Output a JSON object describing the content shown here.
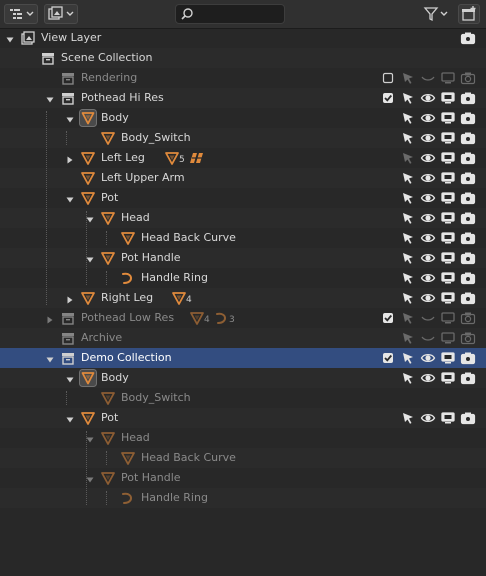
{
  "header": {
    "display_mode_icon": "outliner-display-mode-icon",
    "view_icon": "outliner-view-icon",
    "search": {
      "value": "",
      "placeholder": ""
    },
    "filter_icon": "filter-icon",
    "new_collection_icon": "new-collection-icon"
  },
  "colors": {
    "background": "#282828",
    "row_alt": "#2b2b2b",
    "selected_row": "#334d80",
    "object_orange": "#e08a3c",
    "collection_gray": "#d0d0d0"
  },
  "rows": [
    {
      "label": "View Layer",
      "depth": 0,
      "icon": "view-layer-icon",
      "expand": "open",
      "toggles": [
        "camera"
      ]
    },
    {
      "label": "Scene Collection",
      "depth": 1,
      "icon": "scene-collection-icon",
      "expand": "none",
      "toggles": []
    },
    {
      "label": "Rendering",
      "depth": 2,
      "icon": "collection-icon",
      "expand": "none",
      "dim": true,
      "toggles": [
        "checkbox-off",
        "select-off",
        "eye-closed",
        "monitor-off",
        "camera-off"
      ]
    },
    {
      "label": "Pothead Hi Res",
      "depth": 2,
      "icon": "collection-icon",
      "expand": "open",
      "toggles": [
        "checkbox-on",
        "select",
        "eye",
        "monitor",
        "camera"
      ]
    },
    {
      "label": "Body",
      "depth": 3,
      "icon": "object-boxed-icon",
      "expand": "open",
      "toggles": [
        "select",
        "eye",
        "monitor",
        "camera"
      ]
    },
    {
      "label": "Body_Switch",
      "depth": 4,
      "icon": "object-icon",
      "expand": "none",
      "toggles": [
        "select",
        "eye",
        "monitor",
        "camera"
      ]
    },
    {
      "label": "Left Leg",
      "depth": 3,
      "icon": "object-icon",
      "expand": "closed",
      "toggles": [
        "select-off",
        "eye",
        "monitor",
        "camera"
      ],
      "badges": [
        {
          "icon": "object-icon",
          "count": "5"
        },
        {
          "icon": "modifier-icon",
          "count": ""
        }
      ]
    },
    {
      "label": "Left Upper Arm",
      "depth": 3,
      "icon": "object-icon",
      "expand": "none",
      "toggles": [
        "select",
        "eye",
        "monitor",
        "camera"
      ]
    },
    {
      "label": "Pot",
      "depth": 3,
      "icon": "object-icon",
      "expand": "open",
      "toggles": [
        "select",
        "eye",
        "monitor",
        "camera"
      ]
    },
    {
      "label": "Head",
      "depth": 4,
      "icon": "object-icon",
      "expand": "open",
      "toggles": [
        "select",
        "eye",
        "monitor",
        "camera"
      ]
    },
    {
      "label": "Head Back Curve",
      "depth": 5,
      "icon": "object-icon",
      "expand": "none",
      "toggles": [
        "select",
        "eye",
        "monitor",
        "camera"
      ]
    },
    {
      "label": "Pot Handle",
      "depth": 4,
      "icon": "object-icon",
      "expand": "open",
      "toggles": [
        "select",
        "eye",
        "monitor",
        "camera"
      ]
    },
    {
      "label": "Handle Ring",
      "depth": 5,
      "icon": "curve-icon",
      "expand": "none",
      "toggles": [
        "select",
        "eye",
        "monitor",
        "camera"
      ]
    },
    {
      "label": "Right Leg",
      "depth": 3,
      "icon": "object-icon",
      "expand": "closed",
      "toggles": [
        "select",
        "eye",
        "monitor",
        "camera"
      ],
      "badges": [
        {
          "icon": "object-icon",
          "count": "4"
        }
      ]
    },
    {
      "label": "Pothead Low Res",
      "depth": 2,
      "icon": "collection-icon",
      "expand": "closed",
      "dim": true,
      "toggles": [
        "checkbox-on",
        "select-off",
        "eye-closed",
        "monitor-off",
        "camera-off"
      ],
      "badges": [
        {
          "icon": "object-icon",
          "count": "4"
        },
        {
          "icon": "curve-icon",
          "count": "3"
        }
      ]
    },
    {
      "label": "Archive",
      "depth": 2,
      "icon": "collection-icon",
      "expand": "none",
      "dim": true,
      "toggles": [
        "select-off",
        "eye-closed",
        "monitor-off",
        "camera-off"
      ]
    },
    {
      "label": "Demo Collection",
      "depth": 2,
      "icon": "collection-icon",
      "expand": "open",
      "selected": true,
      "toggles": [
        "checkbox-on",
        "select",
        "eye",
        "monitor",
        "camera"
      ]
    },
    {
      "label": "Body",
      "depth": 3,
      "icon": "object-boxed-icon",
      "expand": "open",
      "toggles": [
        "select",
        "eye",
        "monitor",
        "camera"
      ]
    },
    {
      "label": "Body_Switch",
      "depth": 4,
      "icon": "object-icon",
      "expand": "none",
      "dim": true,
      "toggles": []
    },
    {
      "label": "Pot",
      "depth": 3,
      "icon": "object-icon",
      "expand": "open",
      "toggles": [
        "select",
        "eye",
        "monitor",
        "camera"
      ]
    },
    {
      "label": "Head",
      "depth": 4,
      "icon": "object-icon",
      "expand": "open",
      "dim": true,
      "toggles": []
    },
    {
      "label": "Head Back Curve",
      "depth": 5,
      "icon": "object-icon",
      "expand": "none",
      "dim": true,
      "toggles": []
    },
    {
      "label": "Pot Handle",
      "depth": 4,
      "icon": "object-icon",
      "expand": "open",
      "dim": true,
      "toggles": []
    },
    {
      "label": "Handle Ring",
      "depth": 5,
      "icon": "curve-icon",
      "expand": "none",
      "dim": true,
      "toggles": []
    }
  ]
}
